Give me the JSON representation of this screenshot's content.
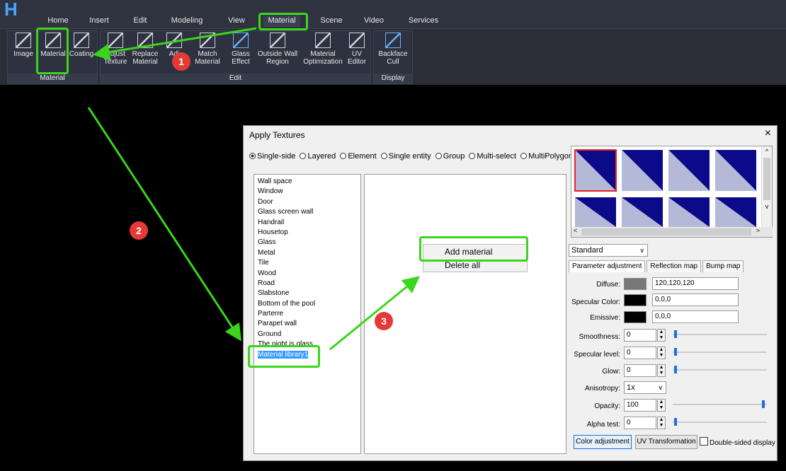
{
  "ribbon": {
    "tabs": [
      "Home",
      "Insert",
      "Edit",
      "Modeling",
      "View",
      "Material",
      "Scene",
      "Video",
      "Services"
    ],
    "active_tab": "Material",
    "groups": {
      "material": {
        "label": "Material",
        "buttons": [
          "Image",
          "Material",
          "Coating"
        ]
      },
      "edit": {
        "label": "Edit",
        "buttons": [
          "Adjust Texture",
          "Replace Material",
          "Adjust",
          "Match Material",
          "Glass Effect",
          "Outside Wall Region",
          "Material Optimization",
          "UV Editor"
        ]
      },
      "display": {
        "label": "Display",
        "buttons": [
          "Backface Cull"
        ]
      }
    },
    "partial_label_adj": "Adj",
    "partial_label_nt": "nt"
  },
  "dialog": {
    "title": "Apply Textures",
    "close": "×",
    "modes": [
      "Single-side",
      "Layered",
      "Element",
      "Single entity",
      "Group",
      "Multi-select",
      "MultiPolygon"
    ],
    "selected_mode": "Single-side",
    "categories": [
      "Wall space",
      "Window",
      "Door",
      "Glass screen wall",
      "Handrail",
      "Housetop",
      "Glass",
      "Metal",
      "Tile",
      "Wood",
      "Road",
      "Slabstone",
      "Bottom of the pool",
      "Parterre",
      "Parapet wall",
      "Ground",
      "The night is glass",
      "Material library1"
    ],
    "selected_category": "Material library1",
    "context_menu": {
      "add": "Add material",
      "delete": "Delete all"
    },
    "material_type": "Standard",
    "param_tabs": [
      "Parameter adjustment",
      "Reflection map",
      "Bump map"
    ],
    "params": {
      "diffuse": {
        "label": "Diffuse:",
        "value": "120,120,120",
        "color": "#787878"
      },
      "specular_color": {
        "label": "Specular Color:",
        "value": "0,0,0",
        "color": "#000000"
      },
      "emissive": {
        "label": "Emissive:",
        "value": "0,0,0",
        "color": "#000000"
      },
      "smoothness": {
        "label": "Smoothness:",
        "value": "0"
      },
      "specular_level": {
        "label": "Specular level:",
        "value": "0"
      },
      "glow": {
        "label": "Glow:",
        "value": "0"
      },
      "anisotropy": {
        "label": "Anisotropy:",
        "value": "1x"
      },
      "opacity": {
        "label": "Opacity:",
        "value": "100"
      },
      "alpha_test": {
        "label": "Alpha test:",
        "value": "0"
      }
    },
    "buttons": {
      "color_adjustment": "Color adjustment",
      "uv_transformation": "UV Transformation",
      "double_sided": "Double-sided display"
    }
  },
  "annotations": [
    "1",
    "2",
    "3"
  ],
  "colors": {
    "highlight": "#3ad61a",
    "badge": "#e53935",
    "thumb_dark": "#0b0b8a",
    "thumb_light": "#b5b9d8"
  }
}
